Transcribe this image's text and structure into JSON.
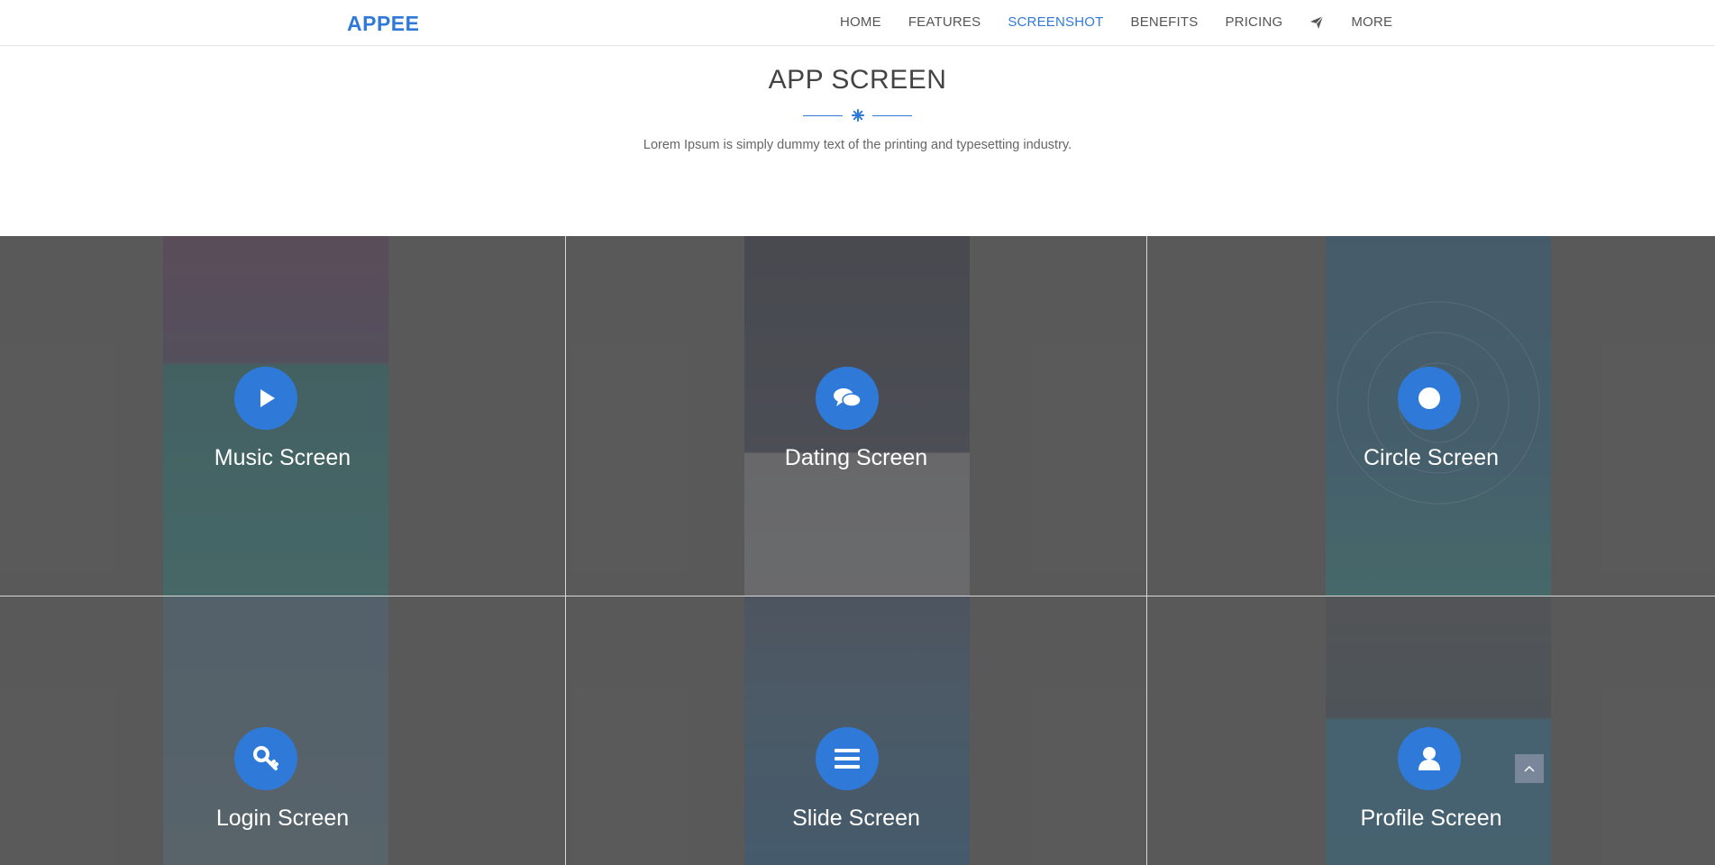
{
  "nav": {
    "brand": "APPEE",
    "items": [
      "HOME",
      "FEATURES",
      "SCREENSHOT",
      "BENEFITS",
      "PRICING",
      "MORE"
    ],
    "active_item": "SCREENSHOT",
    "send_icon": "paper-plane-icon"
  },
  "section": {
    "title": "APP SCREEN",
    "subtitle": "Lorem Ipsum is simply dummy text of the printing and typesetting industry."
  },
  "screens": [
    {
      "label": "Music Screen",
      "icon": "play-icon"
    },
    {
      "label": "Dating Screen",
      "icon": "chat-icon"
    },
    {
      "label": "Circle Screen",
      "icon": "circle-icon"
    },
    {
      "label": "Login Screen",
      "icon": "key-icon"
    },
    {
      "label": "Slide Screen",
      "icon": "menu-icon"
    },
    {
      "label": "Profile Screen",
      "icon": "user-icon"
    }
  ],
  "colors": {
    "accent": "#2f7ad8",
    "grid_bg": "#5c5c5c"
  }
}
